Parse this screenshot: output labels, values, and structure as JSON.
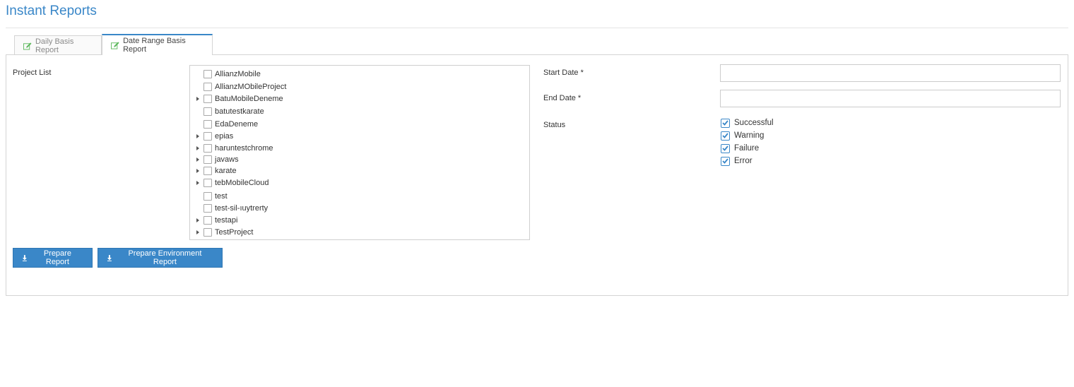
{
  "page": {
    "title": "Instant Reports"
  },
  "tabs": [
    {
      "label": "Daily Basis Report",
      "icon": "edit-icon",
      "active": false
    },
    {
      "label": "Date Range Basis Report",
      "icon": "edit-icon",
      "active": true
    }
  ],
  "form": {
    "project_list_label": "Project List",
    "start_date_label": "Start Date *",
    "end_date_label": "End Date *",
    "status_label": "Status",
    "start_date_value": "",
    "end_date_value": ""
  },
  "projects": [
    {
      "name": "AllianzMobile",
      "expandable": false,
      "checked": false
    },
    {
      "name": "AllianzMObileProject",
      "expandable": false,
      "checked": false
    },
    {
      "name": "BatuMobileDeneme",
      "expandable": true,
      "checked": false
    },
    {
      "name": "batutestkarate",
      "expandable": false,
      "checked": false
    },
    {
      "name": "EdaDeneme",
      "expandable": false,
      "checked": false
    },
    {
      "name": "epias",
      "expandable": true,
      "checked": false
    },
    {
      "name": "haruntestchrome",
      "expandable": true,
      "checked": false
    },
    {
      "name": "javaws",
      "expandable": true,
      "checked": false
    },
    {
      "name": "karate",
      "expandable": true,
      "checked": false
    },
    {
      "name": "tebMobileCloud",
      "expandable": true,
      "checked": false
    },
    {
      "name": "test",
      "expandable": false,
      "checked": false
    },
    {
      "name": "test-sil-ıuytrerty",
      "expandable": false,
      "checked": false
    },
    {
      "name": "testapi",
      "expandable": true,
      "checked": false
    },
    {
      "name": "TestProject",
      "expandable": true,
      "checked": false
    }
  ],
  "statuses": [
    {
      "name": "Successful",
      "checked": true
    },
    {
      "name": "Warning",
      "checked": true
    },
    {
      "name": "Failure",
      "checked": true
    },
    {
      "name": "Error",
      "checked": true
    }
  ],
  "buttons": {
    "prepare_report": "Prepare Report",
    "prepare_env_report": "Prepare Environment Report"
  },
  "colors": {
    "accent": "#3a87c8",
    "icon_green": "#5cb85c"
  }
}
